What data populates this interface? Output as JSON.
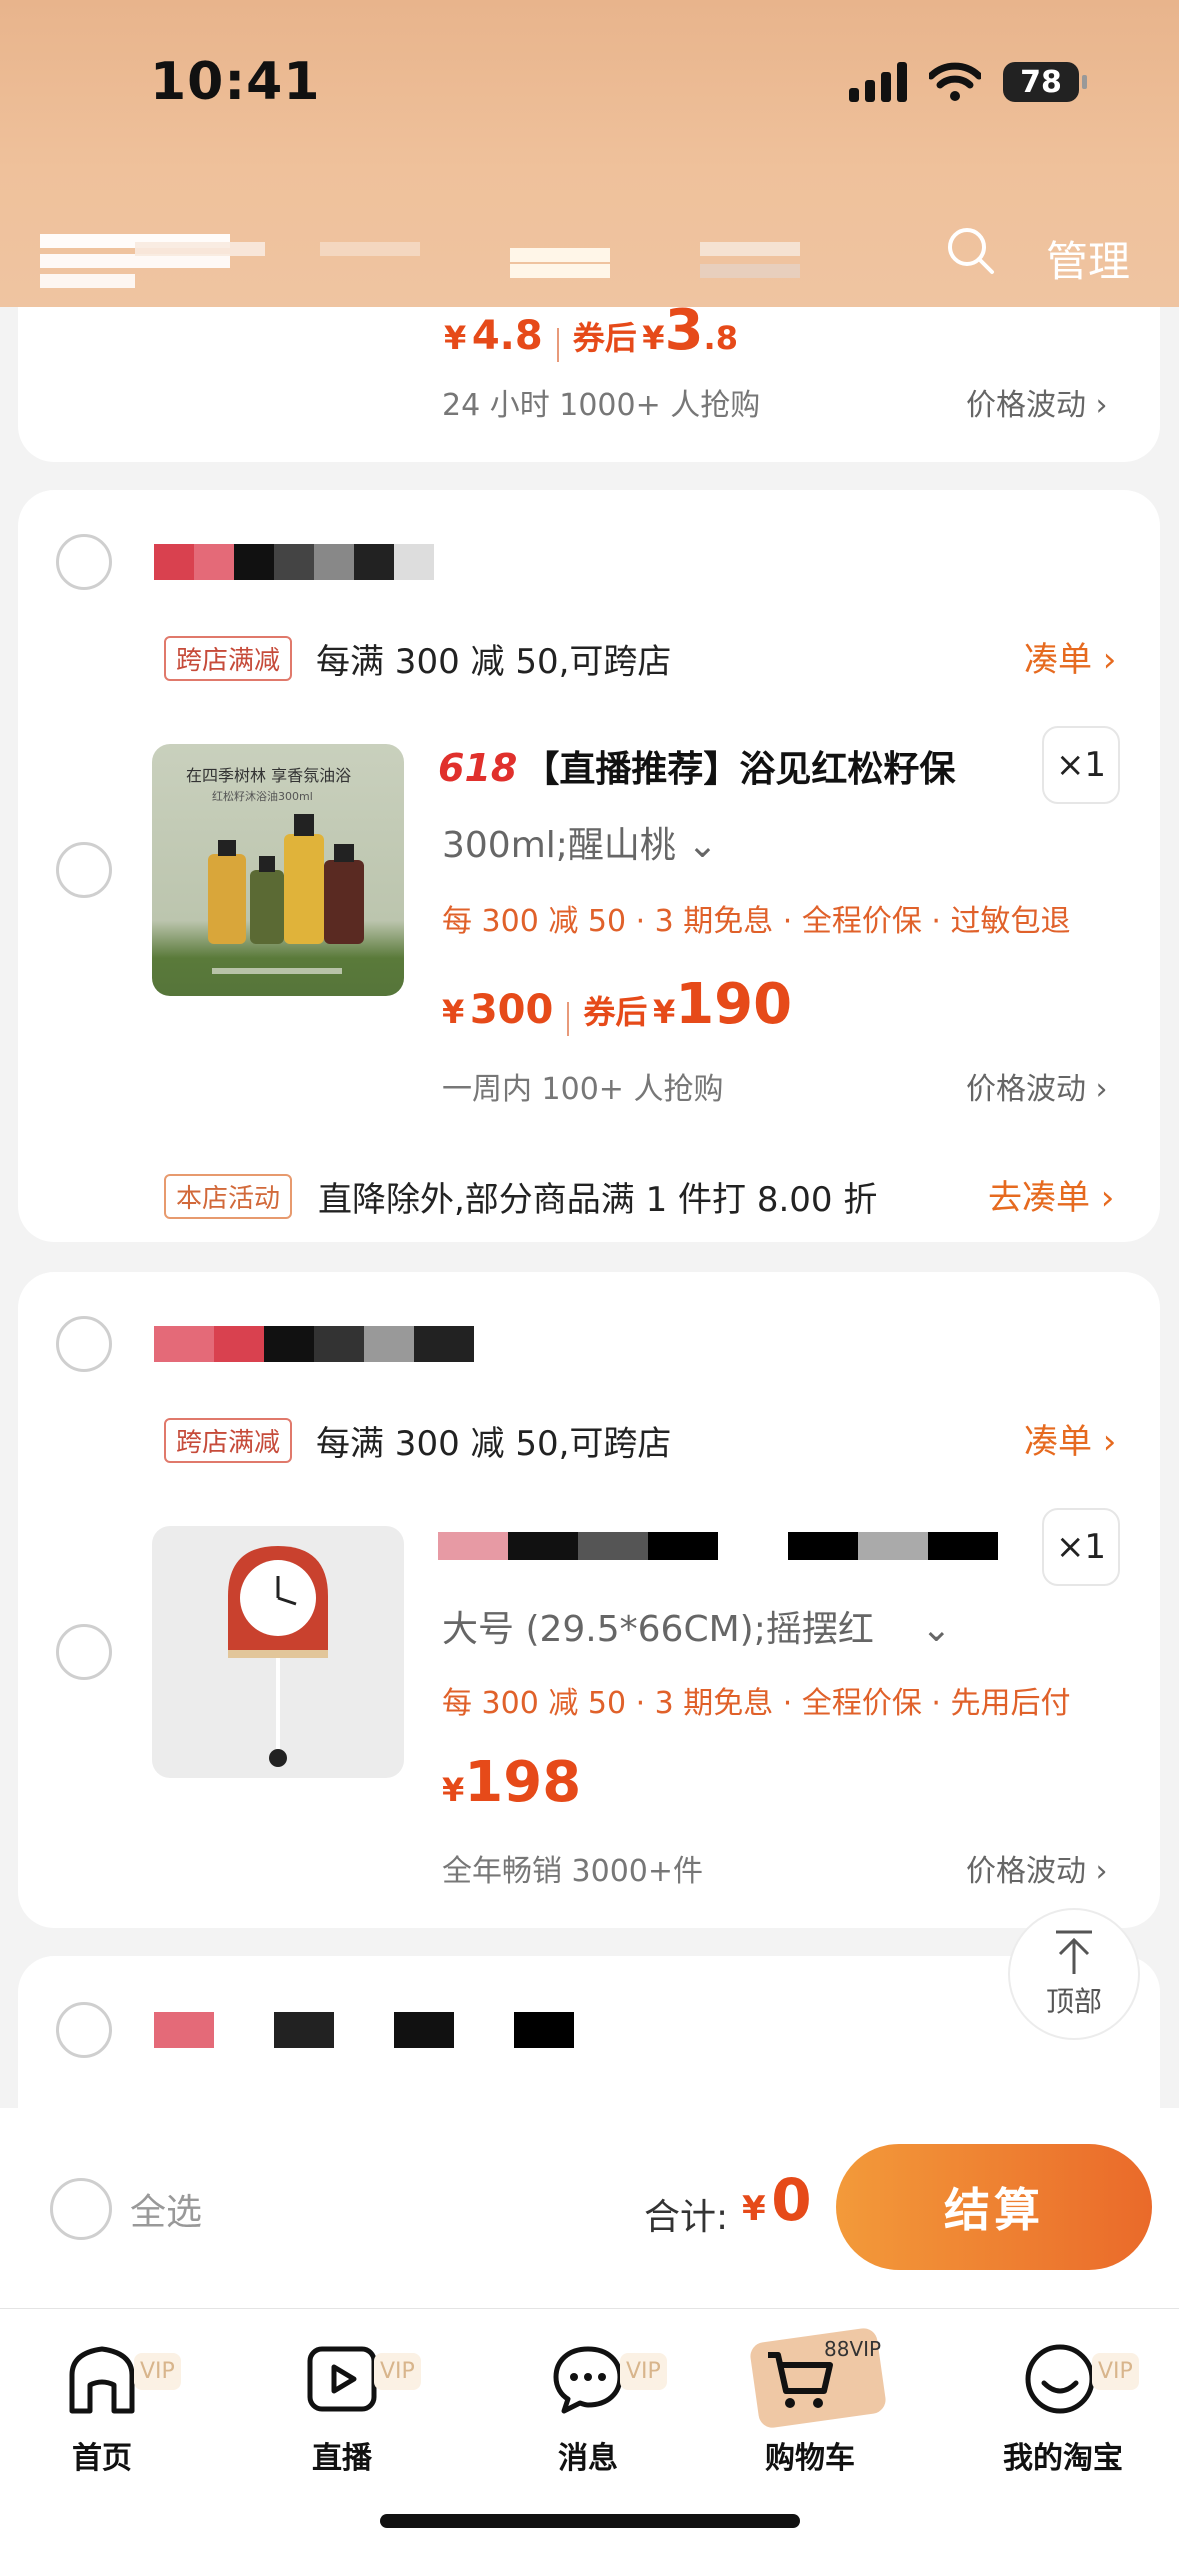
{
  "status_bar": {
    "time": "10:41",
    "battery": "78"
  },
  "header": {
    "manage_label": "管理"
  },
  "card0": {
    "price_yen": "¥",
    "price": "4.8",
    "after_label": "券后",
    "after_yen": "¥",
    "after_price": "3",
    "after_price_dec": ".8",
    "social": "24 小时 1000+ 人抢购",
    "pricewave": "价格波动 ›"
  },
  "card1": {
    "tag": "跨店满减",
    "promo": "每满 300 减 50,可跨店",
    "promo_link": "凑单 ›",
    "title_prefix": "618",
    "title": "【直播推荐】浴见红松籽保",
    "qty": "×1",
    "spec": "300ml;醒山桃 ⌄",
    "benefits": "每 300 减 50 · 3 期免息 · 全程价保 · 过敏包退",
    "price_yen": "¥",
    "price": "300",
    "after_label": "券后",
    "after_yen": "¥",
    "after_price": "190",
    "social": "一周内 100+ 人抢购",
    "pricewave": "价格波动 ›",
    "store_tag": "本店活动",
    "store_promo": "直降除外,部分商品满 1 件打 8.00 折",
    "store_link": "去凑单 ›",
    "thumb_text_1": "在四季树林 享香氛油浴",
    "thumb_text_2": "红松籽沐浴油300ml"
  },
  "card2": {
    "tag": "跨店满减",
    "promo": "每满 300 减 50,可跨店",
    "promo_link": "凑单 ›",
    "qty": "×1",
    "spec": "大号 (29.5*66CM);摇摆红",
    "spec_arrow": "⌄",
    "benefits": "每 300 减 50 · 3 期免息 · 全程价保 · 先用后付",
    "price_yen": "¥",
    "price": "198",
    "social": "全年畅销 3000+件",
    "pricewave": "价格波动 ›"
  },
  "to_top": {
    "label": "顶部"
  },
  "checkout": {
    "select_all": "全选",
    "total_label": "合计:",
    "total_yen": "¥",
    "total": "0",
    "pay": "结算"
  },
  "tabs": [
    {
      "label": "首页",
      "vip": "VIP",
      "icon": "home-icon"
    },
    {
      "label": "直播",
      "vip": "VIP",
      "icon": "live-icon"
    },
    {
      "label": "消息",
      "vip": "VIP",
      "icon": "message-icon"
    },
    {
      "label": "购物车",
      "vip": "88VIP",
      "icon": "cart-icon"
    },
    {
      "label": "我的淘宝",
      "vip": "VIP",
      "icon": "profile-icon"
    }
  ],
  "colors": {
    "accent": "#e64a19",
    "header": "#efc19b",
    "pay_start": "#f39a3a",
    "pay_end": "#ea6a2a"
  }
}
